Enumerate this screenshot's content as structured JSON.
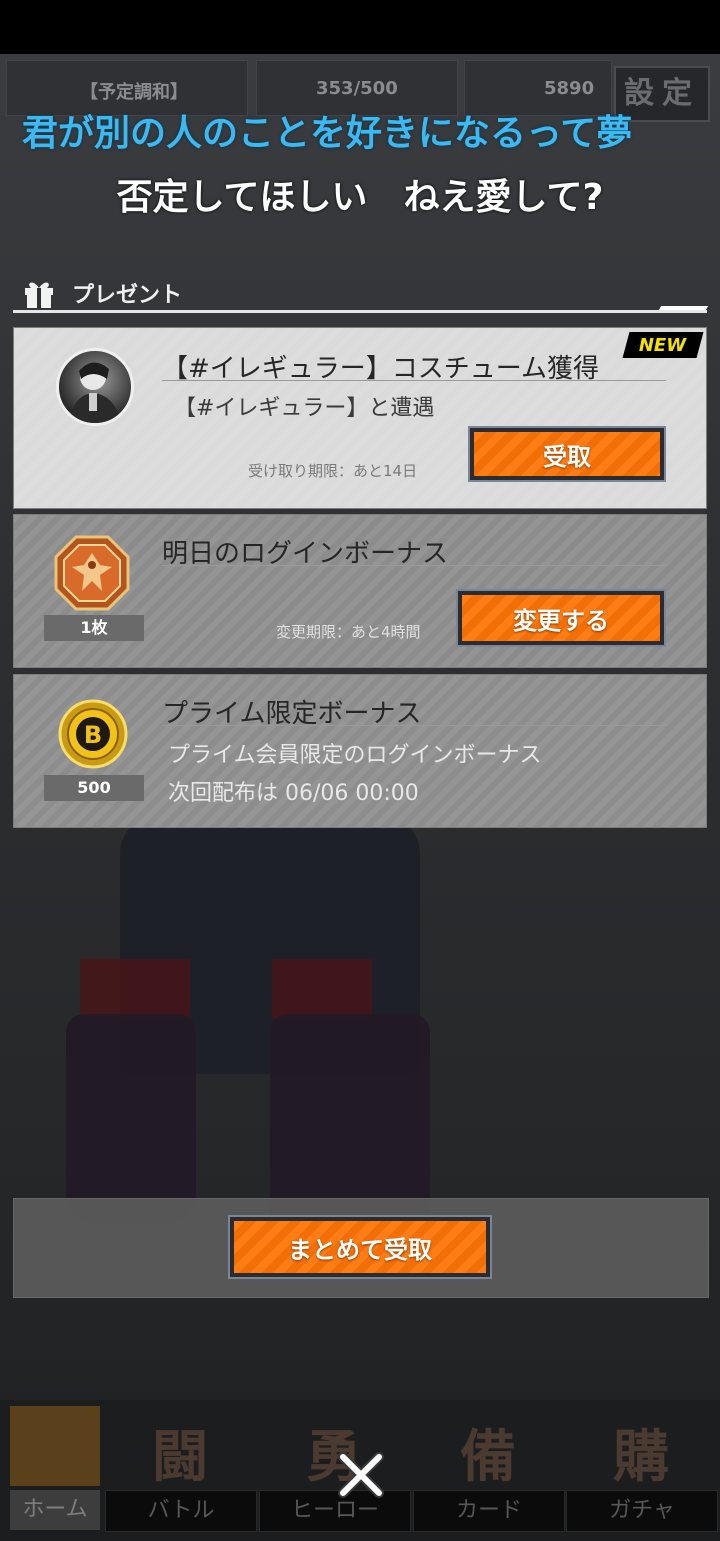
{
  "hud": {
    "status_label": "【予定調和】",
    "stamina": "353/500",
    "coins": "5890",
    "settings_label": "設定"
  },
  "lyrics": {
    "line1": "君が別の人のことを好きになるって夢",
    "line2": "否定してほしい　ねえ愛して?"
  },
  "section": {
    "title": "プレゼント"
  },
  "presents": [
    {
      "badge": "NEW",
      "title": "【#イレギュラー】コスチューム獲得",
      "subtitle": "【#イレギュラー】と遭遇",
      "deadline": "受け取り期限：あと14日",
      "button": "受取"
    },
    {
      "qty": "1枚",
      "title": "明日のログインボーナス",
      "deadline": "変更期限：あと4時間",
      "button": "変更する"
    },
    {
      "qty": "500",
      "title": "プライム限定ボーナス",
      "subtitle": "プライム会員限定のログインボーナス",
      "subtitle2": "次回配布は 06/06 00:00"
    }
  ],
  "collect_all": "まとめて受取",
  "nav": {
    "home": "ホーム",
    "items": [
      {
        "glyph": "闘",
        "label": "バトル"
      },
      {
        "glyph": "勇",
        "label": "ヒーロー"
      },
      {
        "glyph": "備",
        "label": "カード"
      },
      {
        "glyph": "購",
        "label": "ガチャ"
      }
    ]
  },
  "colors": {
    "accent": "#ff7d14",
    "lyric_blue": "#3db9f2",
    "badge_yellow": "#f6e200"
  }
}
